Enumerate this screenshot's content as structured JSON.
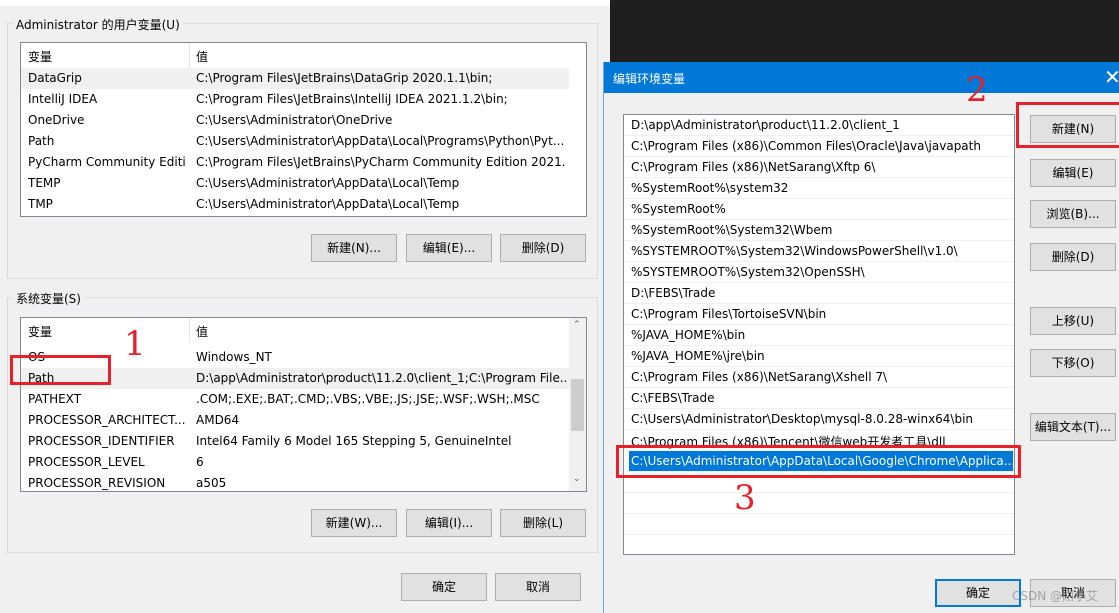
{
  "user_vars": {
    "title": "Administrator 的用户变量(U)",
    "col_name": "变量",
    "col_value": "值",
    "rows": [
      {
        "name": "DataGrip",
        "value": "C:\\Program Files\\JetBrains\\DataGrip 2020.1.1\\bin;"
      },
      {
        "name": "IntelliJ IDEA",
        "value": "C:\\Program Files\\JetBrains\\IntelliJ IDEA 2021.1.2\\bin;"
      },
      {
        "name": "OneDrive",
        "value": "C:\\Users\\Administrator\\OneDrive"
      },
      {
        "name": "Path",
        "value": "C:\\Users\\Administrator\\AppData\\Local\\Programs\\Python\\Pyt..."
      },
      {
        "name": "PyCharm Community Editi...",
        "value": "C:\\Program Files\\JetBrains\\PyCharm Community Edition 2021...."
      },
      {
        "name": "TEMP",
        "value": "C:\\Users\\Administrator\\AppData\\Local\\Temp"
      },
      {
        "name": "TMP",
        "value": "C:\\Users\\Administrator\\AppData\\Local\\Temp"
      }
    ],
    "buttons": {
      "new": "新建(N)...",
      "edit": "编辑(E)...",
      "delete": "删除(D)"
    }
  },
  "system_vars": {
    "title": "系统变量(S)",
    "col_name": "变量",
    "col_value": "值",
    "rows": [
      {
        "name": "OS",
        "value": "Windows_NT"
      },
      {
        "name": "Path",
        "value": "D:\\app\\Administrator\\product\\11.2.0\\client_1;C:\\Program File..."
      },
      {
        "name": "PATHEXT",
        "value": ".COM;.EXE;.BAT;.CMD;.VBS;.VBE;.JS;.JSE;.WSF;.WSH;.MSC"
      },
      {
        "name": "PROCESSOR_ARCHITECT...",
        "value": "AMD64"
      },
      {
        "name": "PROCESSOR_IDENTIFIER",
        "value": "Intel64 Family 6 Model 165 Stepping 5, GenuineIntel"
      },
      {
        "name": "PROCESSOR_LEVEL",
        "value": "6"
      },
      {
        "name": "PROCESSOR_REVISION",
        "value": "a505"
      }
    ],
    "buttons": {
      "new": "新建(W)...",
      "edit": "编辑(I)...",
      "delete": "删除(L)"
    }
  },
  "main_buttons": {
    "ok": "确定",
    "cancel": "取消"
  },
  "edit_dialog": {
    "title": "编辑环境变量",
    "close_icon": "close-icon",
    "paths": [
      "D:\\app\\Administrator\\product\\11.2.0\\client_1",
      "C:\\Program Files (x86)\\Common Files\\Oracle\\Java\\javapath",
      "C:\\Program Files (x86)\\NetSarang\\Xftp 6\\",
      "%SystemRoot%\\system32",
      "%SystemRoot%",
      "%SystemRoot%\\System32\\Wbem",
      "%SYSTEMROOT%\\System32\\WindowsPowerShell\\v1.0\\",
      "%SYSTEMROOT%\\System32\\OpenSSH\\",
      "D:\\FEBS\\Trade",
      "C:\\Program Files\\TortoiseSVN\\bin",
      "%JAVA_HOME%\\bin",
      "%JAVA_HOME%\\jre\\bin",
      "C:\\Program Files (x86)\\NetSarang\\Xshell 7\\",
      "C:\\FEBS\\Trade",
      "C:\\Users\\Administrator\\Desktop\\mysql-8.0.28-winx64\\bin",
      "C:\\Program Files (x86)\\Tencent\\微信web开发者工具\\dll",
      "C:\\Users\\Administrator\\AppData\\Local\\Google\\Chrome\\Applica..."
    ],
    "selected_index": 16,
    "buttons": {
      "new": "新建(N)",
      "edit": "编辑(E)",
      "browse": "浏览(B)...",
      "delete": "删除(D)",
      "up": "上移(U)",
      "down": "下移(O)",
      "edit_text": "编辑文本(T)...",
      "ok": "确定",
      "cancel": "取消"
    }
  },
  "annotations": {
    "step1": "1",
    "step2": "2",
    "step3": "3",
    "color": "#e8202a"
  },
  "watermark": "CSDN @刚小艾"
}
